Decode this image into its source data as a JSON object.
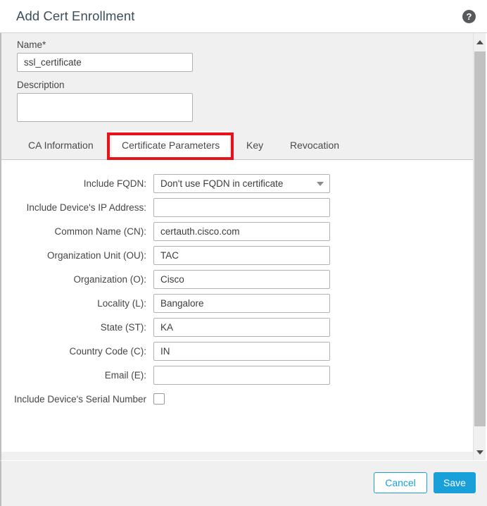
{
  "header": {
    "title": "Add Cert Enrollment",
    "help_icon": "help-circle-icon",
    "help_glyph": "?"
  },
  "top_form": {
    "name": {
      "label": "Name*",
      "value": "ssl_certificate",
      "placeholder": ""
    },
    "description": {
      "label": "Description",
      "value": "",
      "placeholder": ""
    }
  },
  "tabs": {
    "items": [
      {
        "label": "CA Information",
        "active": false
      },
      {
        "label": "Certificate Parameters",
        "active": true
      },
      {
        "label": "Key",
        "active": false
      },
      {
        "label": "Revocation",
        "active": false
      }
    ],
    "highlight_color": "#e8131a",
    "highlighted_tab": "Certificate Parameters"
  },
  "certificate_parameters": {
    "fields": [
      {
        "label": "Include FQDN:",
        "type": "select",
        "value": "Don't use FQDN in certificate",
        "options": [
          "Don't use FQDN in certificate"
        ],
        "name": "include-fqdn"
      },
      {
        "label": "Include Device's IP Address:",
        "type": "text",
        "value": "",
        "placeholder": "",
        "name": "include-device-ip-address"
      },
      {
        "label": "Common Name (CN):",
        "type": "text",
        "value": "certauth.cisco.com",
        "placeholder": "",
        "name": "common-name"
      },
      {
        "label": "Organization Unit (OU):",
        "type": "text",
        "value": "TAC",
        "placeholder": "",
        "name": "organization-unit"
      },
      {
        "label": "Organization (O):",
        "type": "text",
        "value": "Cisco",
        "placeholder": "",
        "name": "organization"
      },
      {
        "label": "Locality (L):",
        "type": "text",
        "value": "Bangalore",
        "placeholder": "",
        "name": "locality"
      },
      {
        "label": "State (ST):",
        "type": "text",
        "value": "KA",
        "placeholder": "",
        "name": "state"
      },
      {
        "label": "Country Code (C):",
        "type": "text",
        "value": "IN",
        "placeholder": "",
        "name": "country-code"
      },
      {
        "label": "Email (E):",
        "type": "text",
        "value": "",
        "placeholder": "",
        "name": "email"
      }
    ],
    "serial_number": {
      "label": "Include Device's Serial Number",
      "checked": false
    }
  },
  "scrollbar": {
    "up_arrow": "chevron-up-icon",
    "down_arrow": "chevron-down-icon"
  },
  "footer": {
    "cancel_label": "Cancel",
    "save_label": "Save",
    "accent_color": "#1aa0d8"
  }
}
